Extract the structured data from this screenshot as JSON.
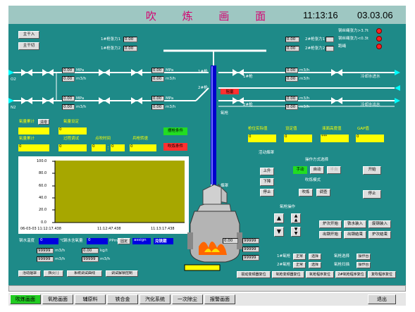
{
  "header": {
    "title": "吹 炼 画 面",
    "time": "11:13:16",
    "date": "03.03.06"
  },
  "left_buttons": [
    "主干入",
    "主干切"
  ],
  "lance_tension": {
    "l1": "1#枪张力1",
    "v1": "0.00",
    "l2": "1#枪张力2",
    "v2": "0.00"
  },
  "lance2_tension": {
    "l1": "2#枪张力1",
    "v1": "0.00",
    "l2": "2#枪张力2",
    "v2": "0.00"
  },
  "alarms": [
    "钢丝绳张力>3.7t",
    "钢丝绳张力<0.3t",
    "跑绳"
  ],
  "pipe_labels": {
    "o2": "O2",
    "n2": "N2",
    "gun1": "1#枪",
    "gun2": "2#枪",
    "gun1_r": "1#枪",
    "gun2_r": "2#枪",
    "cool_in": "冷却水进水",
    "cool_out": "冷却水出水"
  },
  "gauges": {
    "mpa": "MPa",
    "m3h": "m3/h",
    "zero": "0.00",
    "zero2": "0"
  },
  "oxygen": {
    "acc_label": "氧量累计",
    "acc_btn": "清零",
    "set_label": "氧量设定",
    "total_label": "氧量累计",
    "process_label": "过程调试",
    "ignite_label": "点吹时间",
    "ignite_mm": "0",
    "ignite_ss": "0",
    "lance_speed_label": "兵枪转速",
    "zero": "0"
  },
  "blow_cond": {
    "ok": "摆枪条件",
    "bad": "吹炼条件"
  },
  "lance_pos": {
    "actual": "枪位实际值",
    "setv": "设定值",
    "bath": "液面高度值",
    "gap": "GAP值",
    "actual_v": "0",
    "set_v": "0",
    "bath_v": "***",
    "gap_v": "0"
  },
  "sleeve_label": "活动烟罩",
  "op_mode": {
    "label": "操作方式选择",
    "manual": "手动",
    "auto": "自动",
    "semi": "半自"
  },
  "blow_mode": {
    "label": "吹炼模式",
    "b1": "吹炼",
    "b2": "调查"
  },
  "ctrl": {
    "up": "上升",
    "down": "下降",
    "stop": "停止",
    "start": "开始",
    "stop2": "停止"
  },
  "lance_op": "氧枪操作",
  "furnace_btns": [
    [
      "炉次开始",
      "铁水装入",
      "废钢装入"
    ],
    [
      "出钢开始",
      "出钢结束",
      "炉次结束"
    ]
  ],
  "trend": {
    "yticks": [
      "100.0",
      "80.0",
      "60.0",
      "40.0",
      "20.0",
      "0.0"
    ],
    "xt1": "06-03-03 11:12:17.438",
    "xt2": "11:12:47.438",
    "xt3": "11:13:17.438"
  },
  "temp": {
    "label": "钢水温度",
    "v": "0",
    "unit": "℃"
  },
  "carbon": {
    "label": "钢水含氧量",
    "v": "0",
    "unit": "PPm",
    "b1": "固定",
    "b2": "assign",
    "b3": "兑铁期"
  },
  "nums": {
    "a": "99999",
    "u1": "m3/h",
    "b": "99999",
    "u2": "m3/h",
    "c": "99999",
    "u3": "m3/h",
    "d": "99999",
    "e": "99999",
    "f": "99999",
    "g": "0.00",
    "h": "0.00",
    "k": "kg/t"
  },
  "bottom_btns": [
    "活动烟罩",
    "挡火门",
    "系统调试曲线",
    "调试解锁控制"
  ],
  "right_bottom": {
    "g1": "1#氧枪",
    "g2": "2#氧枪",
    "st1": "正常",
    "st2": "正常",
    "sel1": "选择",
    "sel2": "选择",
    "lab1": "氧枪选择",
    "lab2": "氧枪扫描",
    "lab3": "操作台",
    "lab4": "操作台"
  },
  "reset_btns": [
    "损动变频器复位",
    "氧枪变频器复位",
    "氧枪程序复位",
    "2#氧枪程序复位",
    "复吹程序复位"
  ],
  "tabs": [
    "吹炼画面",
    "氧枪画面",
    "辅原料",
    "铁合金",
    "汽化系统",
    "一次除尘",
    "报警画面"
  ],
  "exit": "退出",
  "lance_label": "氧枪",
  "hood_label": "烟罩",
  "block_label": "阻塞",
  "colors": {
    "panel": "#1e8a88",
    "title": "#d40070",
    "yellow": "#ffff00",
    "blue": "#0000e0",
    "green": "#22dd22",
    "red": "#ff3030"
  }
}
